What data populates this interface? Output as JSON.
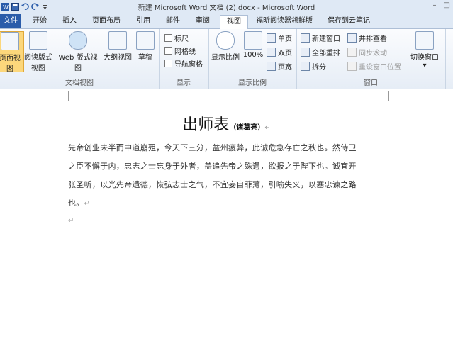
{
  "window": {
    "title": "新建 Microsoft Word 文档 (2).docx - Microsoft Word",
    "minimize": "–",
    "maximize": "□"
  },
  "tabs": [
    "文件",
    "开始",
    "插入",
    "页面布局",
    "引用",
    "邮件",
    "审阅",
    "视图",
    "福昕阅读器领鲜版",
    "保存到云笔记"
  ],
  "ribbon": {
    "views": {
      "label": "文档视图",
      "buttons": [
        "页面视图",
        "阅读版式\n视图",
        "Web 版式视图",
        "大纲视图",
        "草稿"
      ]
    },
    "show": {
      "label": "显示",
      "items": [
        "标尺",
        "网格线",
        "导航窗格"
      ]
    },
    "zoom": {
      "label": "显示比例",
      "zoom_btn": "显示比例",
      "pct_btn": "100%",
      "single": "单页",
      "double": "双页",
      "width": "页宽"
    },
    "window": {
      "label": "窗口",
      "new_window": "新建窗口",
      "arrange_all": "全部重排",
      "split": "拆分",
      "side_by_side": "并排查看",
      "sync_scroll": "同步滚动",
      "reset_pos": "重设窗口位置",
      "switch": "切换窗口",
      "switch_arrow": "▾"
    }
  },
  "document": {
    "title": "出师表",
    "author": "（诸葛亮）",
    "para_line1": "先帝创业未半而中道崩殂，今天下三分，益州疲弊，此诚危急存亡之秋也。然侍卫",
    "para_line2": "之臣不懈于内，忠志之士忘身于外者，盖追先帝之殊遇，欲报之于陛下也。诚宜开",
    "para_line3": "张圣听，以光先帝遗德，恢弘志士之气，不宜妄自菲薄，引喻失义，以塞忠谏之路",
    "para_line4": "也。",
    "return_mark": "↵"
  }
}
